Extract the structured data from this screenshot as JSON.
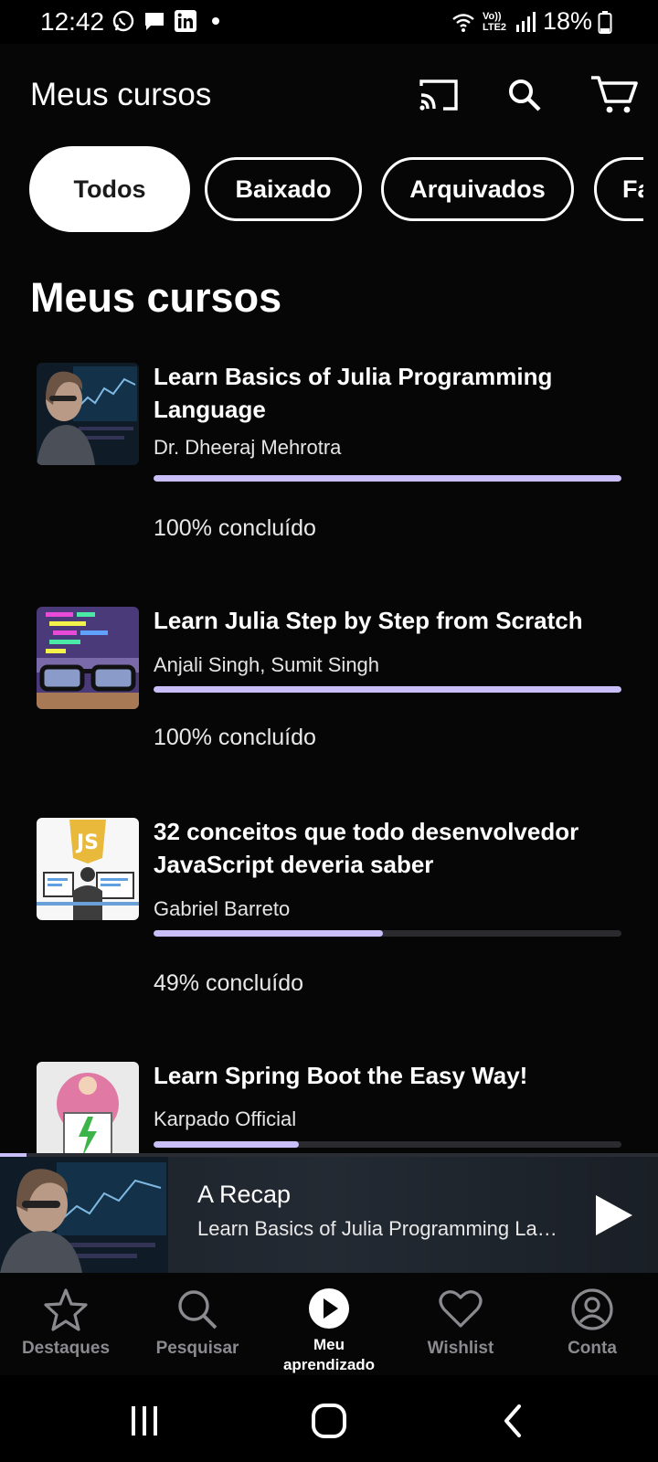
{
  "status_bar": {
    "time": "12:42",
    "battery": "18%",
    "network": "Vo)) LTE2",
    "icons": [
      "whatsapp-icon",
      "message-icon",
      "linkedin-icon"
    ]
  },
  "app_bar": {
    "title": "Meus cursos",
    "actions": [
      "cast-icon",
      "search-icon",
      "cart-icon"
    ]
  },
  "filters": [
    {
      "label": "Todos",
      "active": true
    },
    {
      "label": "Baixado",
      "active": false
    },
    {
      "label": "Arquivados",
      "active": false
    },
    {
      "label": "Fa",
      "active": false
    }
  ],
  "section_title": "Meus cursos",
  "courses": [
    {
      "title": "Learn Basics of Julia Programming Language",
      "author": "Dr. Dheeraj Mehrotra",
      "progress": 1.0,
      "status": "100% concluído"
    },
    {
      "title": "Learn Julia Step by Step from Scratch",
      "author": "Anjali Singh, Sumit Singh",
      "progress": 1.0,
      "status": "100% concluído"
    },
    {
      "title": "32 conceitos que todo desenvolvedor JavaScript deveria saber",
      "author": "Gabriel Barreto",
      "progress": 0.49,
      "status": "49% concluído"
    },
    {
      "title": "Learn Spring Boot the Easy Way!",
      "author": "Karpado Official",
      "progress": 0.31,
      "status": ""
    }
  ],
  "mini_player": {
    "title": "A Recap",
    "subtitle": "Learn Basics of Julia Programming Language",
    "progress": 0.04
  },
  "bottom_nav": [
    {
      "label": "Destaques",
      "icon": "star-icon",
      "active": false
    },
    {
      "label": "Pesquisar",
      "icon": "search-icon",
      "active": false
    },
    {
      "label": "Meu aprendizado",
      "icon": "play-circle-icon",
      "active": true
    },
    {
      "label": "Wishlist",
      "icon": "heart-icon",
      "active": false
    },
    {
      "label": "Conta",
      "icon": "account-icon",
      "active": false
    }
  ],
  "colors": {
    "background": "#060607",
    "progress": "#c9bef7",
    "inactive_nav": "#8a8a8f"
  }
}
